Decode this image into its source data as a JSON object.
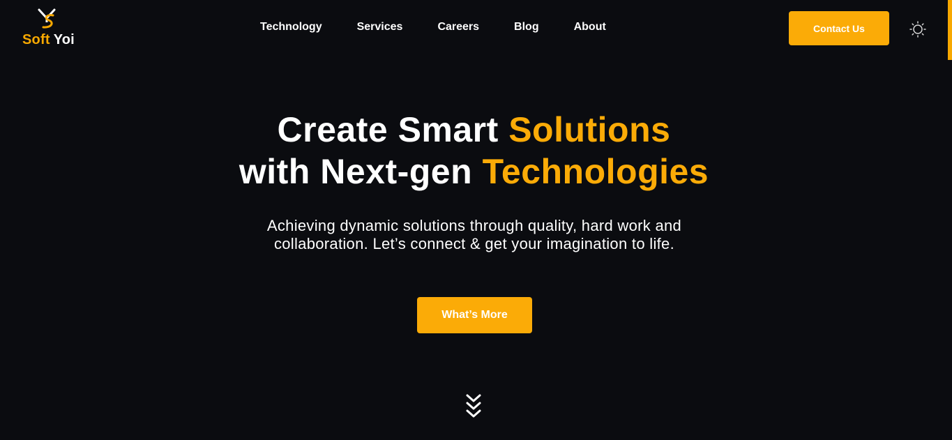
{
  "header": {
    "logo": {
      "mark_icon": "ys-monogram-icon",
      "word_soft": "Soft",
      "word_yoi": "Yoi"
    },
    "nav": [
      {
        "label": "Technology"
      },
      {
        "label": "Services"
      },
      {
        "label": "Careers"
      },
      {
        "label": "Blog"
      },
      {
        "label": "About"
      }
    ],
    "contact_label": "Contact Us",
    "theme_toggle_icon": "sun-icon"
  },
  "hero": {
    "title_line1_a": "Create Smart ",
    "title_line1_b": "Solutions",
    "title_line2_a": "with Next-gen ",
    "title_line2_b": "Technologies",
    "subtitle": "Achieving dynamic solutions through quality, hard work and collaboration. Let’s connect & get your imagination to life.",
    "cta_label": "What’s More",
    "scroll_icon": "triple-chevron-down-icon"
  },
  "colors": {
    "background": "#0b0c10",
    "accent": "#fbab07",
    "text": "#ffffff"
  }
}
